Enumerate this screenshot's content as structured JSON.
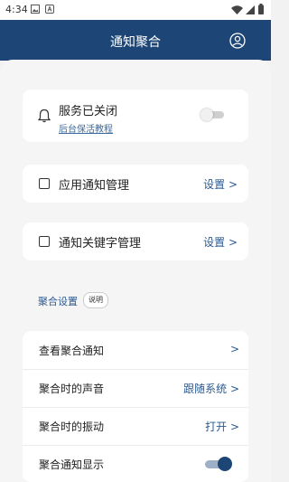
{
  "status_bar": {
    "time": "4:34"
  },
  "app_bar": {
    "title": "通知聚合"
  },
  "service_card": {
    "title": "服务已关闭",
    "link": "后台保活教程"
  },
  "app_notify_card": {
    "label": "应用通知管理",
    "action": "设置 >"
  },
  "keyword_card": {
    "label": "通知关键字管理",
    "action": "设置 >"
  },
  "aggregate_section": {
    "label": "聚合设置",
    "badge": "说明"
  },
  "aggregate_rows": [
    {
      "label": "查看聚合通知",
      "value": ">"
    },
    {
      "label": "聚合时的声音",
      "value": "跟随系统 >"
    },
    {
      "label": "聚合时的振动",
      "value": "打开 >"
    },
    {
      "label": "聚合通知显示",
      "value": ""
    }
  ],
  "colors": {
    "primary": "#1d4676",
    "accent_text": "#2a5a93"
  }
}
